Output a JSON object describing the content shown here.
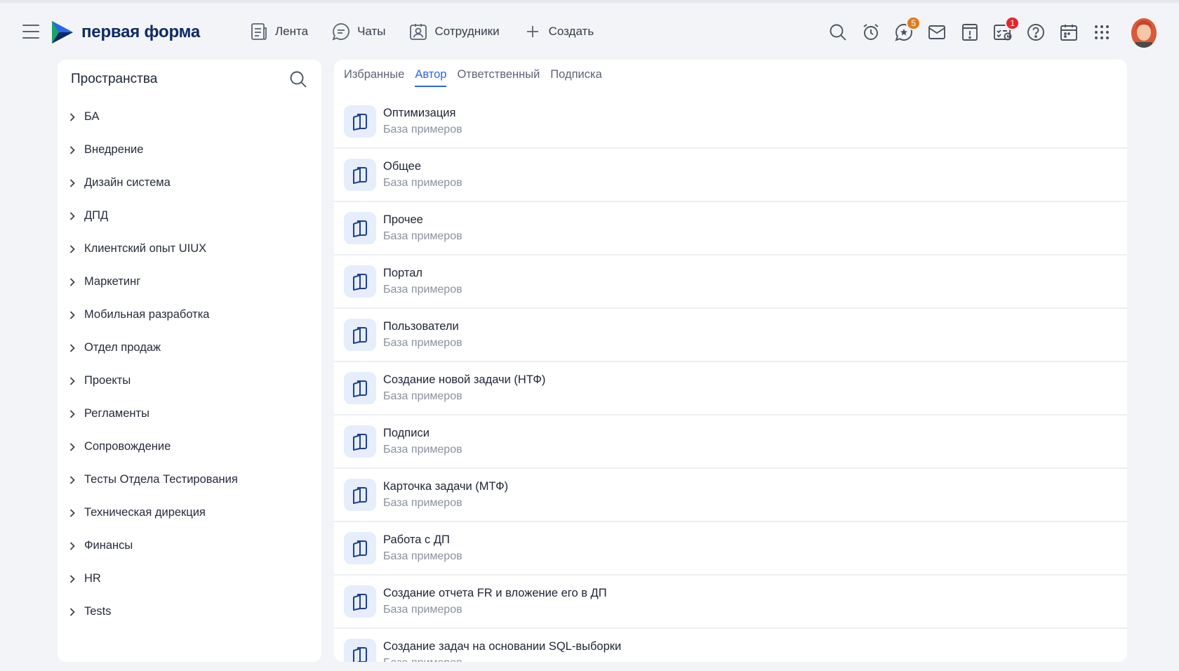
{
  "app": {
    "logo_text": "первая форма",
    "colors": {
      "accent": "#2a66e8",
      "brand_dark": "#0e2a63",
      "badge_orange": "#e07b1a",
      "badge_red": "#e5252a"
    }
  },
  "header": {
    "nav": [
      {
        "label": "Лента",
        "icon": "feed-icon"
      },
      {
        "label": "Чаты",
        "icon": "chat-icon"
      },
      {
        "label": "Сотрудники",
        "icon": "employees-icon"
      },
      {
        "label": "Создать",
        "icon": "plus-icon"
      }
    ],
    "icons": [
      {
        "name": "search-icon"
      },
      {
        "name": "alarm-clock-icon"
      },
      {
        "name": "favorites-icon",
        "badge": "5"
      },
      {
        "name": "mail-icon"
      },
      {
        "name": "alert-icon"
      },
      {
        "name": "approvals-icon",
        "badge": "1"
      },
      {
        "name": "help-icon"
      },
      {
        "name": "calendar-icon"
      },
      {
        "name": "apps-grid-icon"
      }
    ]
  },
  "sidebar": {
    "title": "Пространства",
    "items": [
      {
        "label": "БА"
      },
      {
        "label": "Внедрение"
      },
      {
        "label": "Дизайн система"
      },
      {
        "label": "ДПД"
      },
      {
        "label": "Клиентский опыт UIUX"
      },
      {
        "label": "Маркетинг"
      },
      {
        "label": "Мобильная разработка"
      },
      {
        "label": "Отдел продаж"
      },
      {
        "label": "Проекты"
      },
      {
        "label": "Регламенты"
      },
      {
        "label": "Сопровождение"
      },
      {
        "label": "Тесты Отдела Тестирования"
      },
      {
        "label": "Техническая дирекция"
      },
      {
        "label": "Финансы"
      },
      {
        "label": "HR"
      },
      {
        "label": "Tests"
      }
    ]
  },
  "main": {
    "tabs": [
      {
        "label": "Избранные",
        "active": false
      },
      {
        "label": "Автор",
        "active": true
      },
      {
        "label": "Ответственный",
        "active": false
      },
      {
        "label": "Подписка",
        "active": false
      }
    ],
    "rows": [
      {
        "title": "Оптимизация",
        "subtitle": "База примеров"
      },
      {
        "title": "Общее",
        "subtitle": "База примеров"
      },
      {
        "title": "Прочее",
        "subtitle": "База примеров"
      },
      {
        "title": "Портал",
        "subtitle": "База примеров"
      },
      {
        "title": "Пользователи",
        "subtitle": "База примеров"
      },
      {
        "title": "Создание новой задачи (НТФ)",
        "subtitle": "База примеров"
      },
      {
        "title": "Подписи",
        "subtitle": "База примеров"
      },
      {
        "title": "Карточка задачи (МТФ)",
        "subtitle": "База примеров"
      },
      {
        "title": "Работа с ДП",
        "subtitle": "База примеров"
      },
      {
        "title": "Создание отчета FR и вложение его в ДП",
        "subtitle": "База примеров"
      },
      {
        "title": "Создание задач на основании SQL-выборки",
        "subtitle": "База примеров"
      }
    ]
  }
}
